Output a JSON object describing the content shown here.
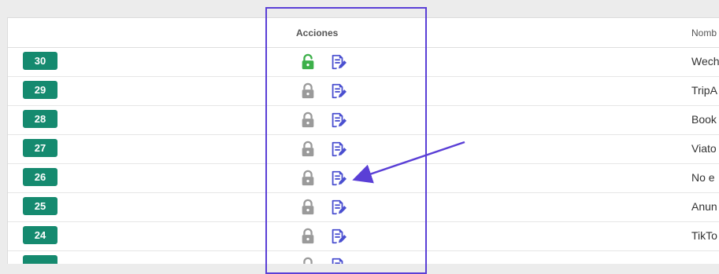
{
  "table": {
    "header": {
      "acciones": "Acciones",
      "nombre": "Nomb"
    },
    "rows": [
      {
        "id": "30",
        "name": "Wech",
        "lock": "unlock-icon",
        "lock_color": "#3db04a"
      },
      {
        "id": "29",
        "name": "TripA",
        "lock": "lock-icon",
        "lock_color": "#9a9a9a"
      },
      {
        "id": "28",
        "name": "Book",
        "lock": "lock-icon",
        "lock_color": "#9a9a9a"
      },
      {
        "id": "27",
        "name": "Viato",
        "lock": "lock-icon",
        "lock_color": "#9a9a9a"
      },
      {
        "id": "26",
        "name": "No e",
        "lock": "lock-icon",
        "lock_color": "#9a9a9a"
      },
      {
        "id": "25",
        "name": "Anun",
        "lock": "lock-icon",
        "lock_color": "#9a9a9a"
      },
      {
        "id": "24",
        "name": "TikTo",
        "lock": "lock-icon",
        "lock_color": "#9a9a9a"
      },
      {
        "id": "",
        "name": "",
        "lock": "lock-icon",
        "lock_color": "#9a9a9a"
      }
    ]
  },
  "colors": {
    "badge": "#158a6f",
    "edit_icon": "#4a4fd0",
    "annotation": "#5a3fd6"
  }
}
